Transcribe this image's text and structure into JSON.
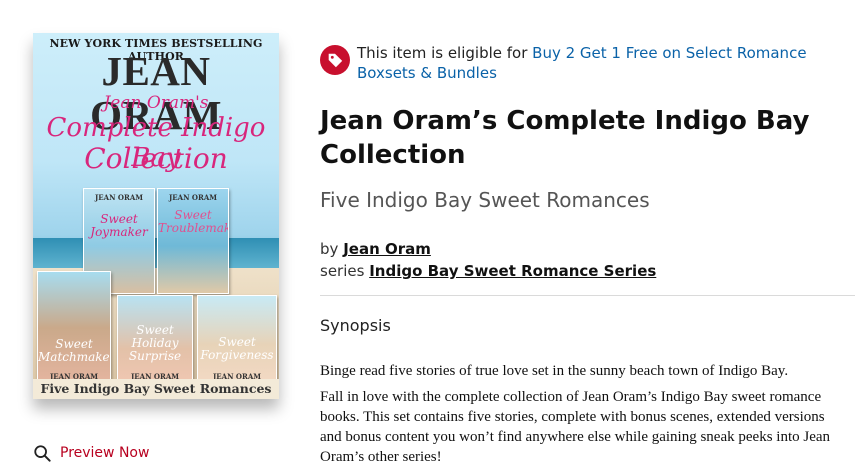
{
  "cover": {
    "banner": "NEW YORK TIMES BESTSELLING AUTHOR",
    "author": "JEAN ORAM",
    "script_line1": "Jean Oram's",
    "script_line2": "Complete Indigo Bay",
    "script_line3": "Collection",
    "footer": "Five Indigo Bay Sweet Romances",
    "books": [
      {
        "title": "Sweet Joymaker",
        "author": "JEAN ORAM"
      },
      {
        "title": "Sweet Troublemaker",
        "author": "JEAN ORAM"
      },
      {
        "title": "Sweet Matchmaker",
        "author": "JEAN ORAM"
      },
      {
        "title": "Sweet Holiday Surprise",
        "author": "JEAN ORAM"
      },
      {
        "title": "Sweet Forgiveness",
        "author": "JEAN ORAM"
      }
    ]
  },
  "preview": {
    "label": "Preview Now",
    "icon": "search-icon"
  },
  "promo": {
    "icon": "price-tag-icon",
    "prefix": "This item is eligible for ",
    "link": "Buy 2 Get 1 Free on Select Romance Boxsets & Bundles"
  },
  "title": "Jean Oram’s Complete Indigo Bay Collection",
  "subtitle": "Five Indigo Bay Sweet Romances",
  "byline": {
    "by_label": "by",
    "author": "Jean Oram",
    "series_label": "series",
    "series": "Indigo Bay Sweet Romance Series"
  },
  "synopsis": {
    "heading": "Synopsis",
    "paragraphs": [
      "Binge read five stories of true love set in the sunny beach town of Indigo Bay.",
      "Fall in love with the complete collection of Jean Oram’s Indigo Bay sweet romance books. This set contains five stories, complete with bonus scenes, extended versions and bonus content you won’t find anywhere else while gaining sneak peeks into Jean Oram’s other series!"
    ]
  },
  "colors": {
    "accent_red": "#c8102e",
    "link_blue": "#0a62a8",
    "preview_red": "#b8001f"
  }
}
